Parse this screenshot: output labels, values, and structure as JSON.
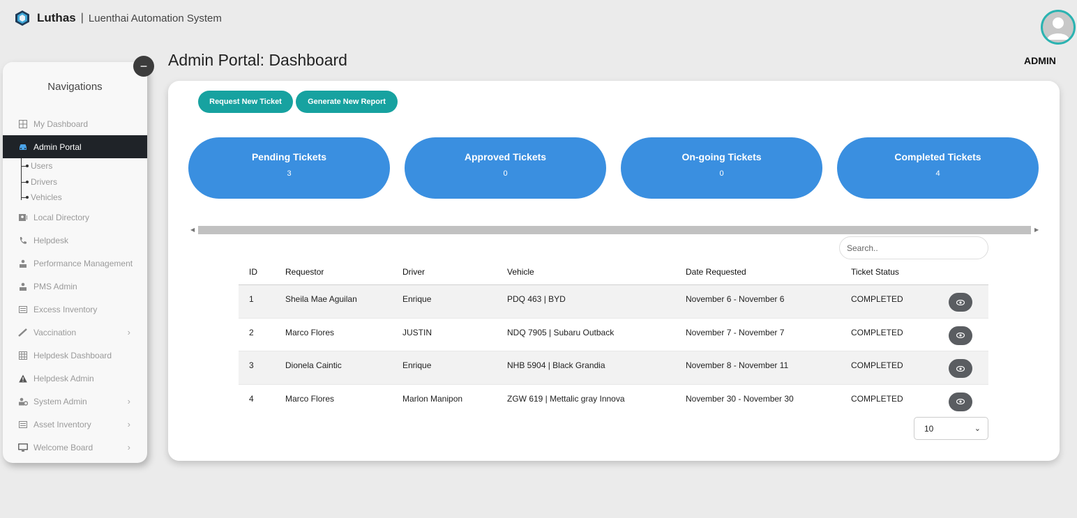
{
  "header": {
    "brand_name": "Luthas",
    "brand_separator": "|",
    "brand_subtitle": "Luenthai Automation System",
    "user_role": "ADMIN"
  },
  "page": {
    "title": "Admin Portal: Dashboard"
  },
  "sidebar": {
    "title": "Navigations",
    "collapse_symbol": "−",
    "items": [
      {
        "label": "My Dashboard",
        "icon": "dashboard-grid-icon"
      },
      {
        "label": "Admin Portal",
        "icon": "car-icon",
        "active": true
      },
      {
        "label": "Local Directory",
        "icon": "contact-card-icon"
      },
      {
        "label": "Helpdesk",
        "icon": "phone-icon"
      },
      {
        "label": "Performance Management",
        "icon": "person-chart-icon"
      },
      {
        "label": "PMS Admin",
        "icon": "person-chart-icon"
      },
      {
        "label": "Excess Inventory",
        "icon": "inventory-icon"
      },
      {
        "label": "Vaccination",
        "icon": "syringe-icon",
        "expandable": true
      },
      {
        "label": "Helpdesk Dashboard",
        "icon": "table-icon"
      },
      {
        "label": "Helpdesk Admin",
        "icon": "warning-icon"
      },
      {
        "label": "System Admin",
        "icon": "users-gear-icon",
        "expandable": true
      },
      {
        "label": "Asset Inventory",
        "icon": "inventory-icon",
        "expandable": true
      },
      {
        "label": "Welcome Board",
        "icon": "monitor-icon",
        "expandable": true
      }
    ],
    "sub_items": [
      "Users",
      "Drivers",
      "Vehicles"
    ]
  },
  "actions": {
    "request_ticket": "Request New Ticket",
    "generate_report": "Generate New Report"
  },
  "stats": [
    {
      "label": "Pending Tickets",
      "value": "3"
    },
    {
      "label": "Approved Tickets",
      "value": "0"
    },
    {
      "label": "On-going Tickets",
      "value": "0"
    },
    {
      "label": "Completed Tickets",
      "value": "4"
    }
  ],
  "search": {
    "placeholder": "Search.."
  },
  "table": {
    "headers": [
      "ID",
      "Requestor",
      "Driver",
      "Vehicle",
      "Date Requested",
      "Ticket Status"
    ],
    "rows": [
      [
        "1",
        "Sheila Mae Aguilan",
        "Enrique",
        "PDQ 463 | BYD",
        "November 6 - November 6",
        "COMPLETED"
      ],
      [
        "2",
        "Marco Flores",
        "JUSTIN",
        "NDQ 7905 | Subaru Outback",
        "November 7 - November 7",
        "COMPLETED"
      ],
      [
        "3",
        "Dionela Caintic",
        "Enrique",
        "NHB 5904 | Black Grandia",
        "November 8 - November 11",
        "COMPLETED"
      ],
      [
        "4",
        "Marco Flores",
        "Marlon Manipon",
        "ZGW 619 | Mettalic gray Innova",
        "November 30 - November 30",
        "COMPLETED"
      ]
    ]
  },
  "pagination": {
    "page_size": "10"
  },
  "colors": {
    "accent_teal": "#17a2a0",
    "stat_blue": "#3a8fe0",
    "sidebar_active": "#1f2328"
  }
}
